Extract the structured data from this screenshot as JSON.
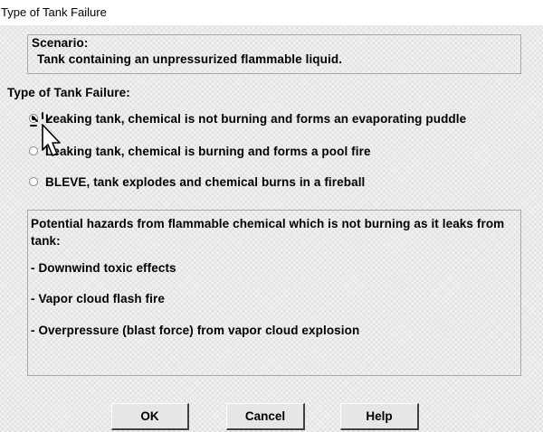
{
  "window": {
    "title": "Type of Tank Failure"
  },
  "scenario": {
    "label": "Scenario:",
    "text": "Tank containing an unpressurized flammable liquid."
  },
  "failure_type": {
    "label": "Type of Tank Failure:",
    "options": [
      {
        "label": "Leaking tank, chemical is not burning and forms an evaporating puddle",
        "selected": true
      },
      {
        "label": "Leaking tank, chemical is burning and forms a pool fire",
        "selected": false
      },
      {
        "label": "BLEVE, tank explodes and chemical burns in a fireball",
        "selected": false
      }
    ]
  },
  "hazards": {
    "description": "Potential hazards from flammable chemical which is not burning as it leaks from tank:",
    "items": [
      "- Downwind toxic effects",
      "- Vapor cloud flash fire",
      "- Overpressure (blast force) from vapor cloud explosion"
    ]
  },
  "buttons": {
    "ok": "OK",
    "cancel": "Cancel",
    "help": "Help"
  }
}
